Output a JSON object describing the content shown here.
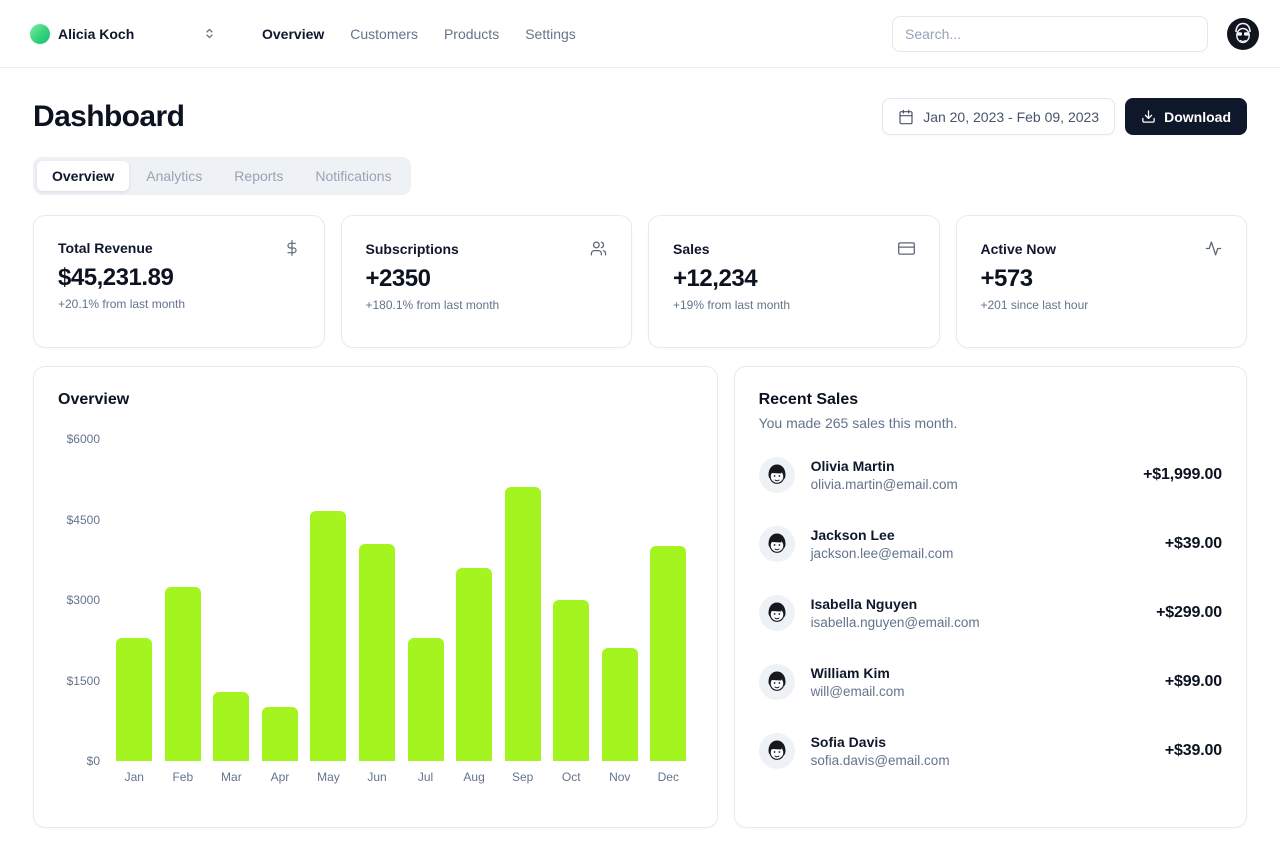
{
  "nav": {
    "team_name": "Alicia Koch",
    "items": [
      {
        "label": "Overview",
        "active": true
      },
      {
        "label": "Customers",
        "active": false
      },
      {
        "label": "Products",
        "active": false
      },
      {
        "label": "Settings",
        "active": false
      }
    ],
    "search_placeholder": "Search..."
  },
  "header": {
    "title": "Dashboard",
    "date_range": "Jan 20, 2023 - Feb 09, 2023",
    "download_label": "Download"
  },
  "tabs": [
    {
      "label": "Overview",
      "active": true
    },
    {
      "label": "Analytics",
      "active": false
    },
    {
      "label": "Reports",
      "active": false
    },
    {
      "label": "Notifications",
      "active": false
    }
  ],
  "stats": [
    {
      "title": "Total Revenue",
      "value": "$45,231.89",
      "change": "+20.1% from last month",
      "icon": "dollar-icon"
    },
    {
      "title": "Subscriptions",
      "value": "+2350",
      "change": "+180.1% from last month",
      "icon": "users-icon"
    },
    {
      "title": "Sales",
      "value": "+12,234",
      "change": "+19% from last month",
      "icon": "credit-card-icon"
    },
    {
      "title": "Active Now",
      "value": "+573",
      "change": "+201 since last hour",
      "icon": "activity-icon"
    }
  ],
  "chart_data": {
    "type": "bar",
    "title": "Overview",
    "categories": [
      "Jan",
      "Feb",
      "Mar",
      "Apr",
      "May",
      "Jun",
      "Jul",
      "Aug",
      "Sep",
      "Oct",
      "Nov",
      "Dec"
    ],
    "values": [
      2300,
      3250,
      1280,
      1000,
      4650,
      4050,
      2300,
      3600,
      5100,
      3000,
      2100,
      4000
    ],
    "xlabel": "",
    "ylabel": "",
    "ylim": [
      0,
      6000
    ],
    "ytick_labels": [
      "$6000",
      "$4500",
      "$3000",
      "$1500",
      "$0"
    ],
    "grid": false,
    "legend": false,
    "bar_color": "#a4f41f"
  },
  "recent_sales": {
    "title": "Recent Sales",
    "subtitle": "You made 265 sales this month.",
    "items": [
      {
        "name": "Olivia Martin",
        "email": "olivia.martin@email.com",
        "amount": "+$1,999.00"
      },
      {
        "name": "Jackson Lee",
        "email": "jackson.lee@email.com",
        "amount": "+$39.00"
      },
      {
        "name": "Isabella Nguyen",
        "email": "isabella.nguyen@email.com",
        "amount": "+$299.00"
      },
      {
        "name": "William Kim",
        "email": "will@email.com",
        "amount": "+$99.00"
      },
      {
        "name": "Sofia Davis",
        "email": "sofia.davis@email.com",
        "amount": "+$39.00"
      }
    ]
  },
  "colors": {
    "accent_bar": "#a4f41f",
    "foreground": "#0f172a",
    "muted": "#64748b",
    "border": "#e2e8f0",
    "dark_button": "#0f172a",
    "tab_bg": "#eef1f6",
    "team_avatar_gradient": [
      "#7ef0a4",
      "#1fb981"
    ]
  }
}
